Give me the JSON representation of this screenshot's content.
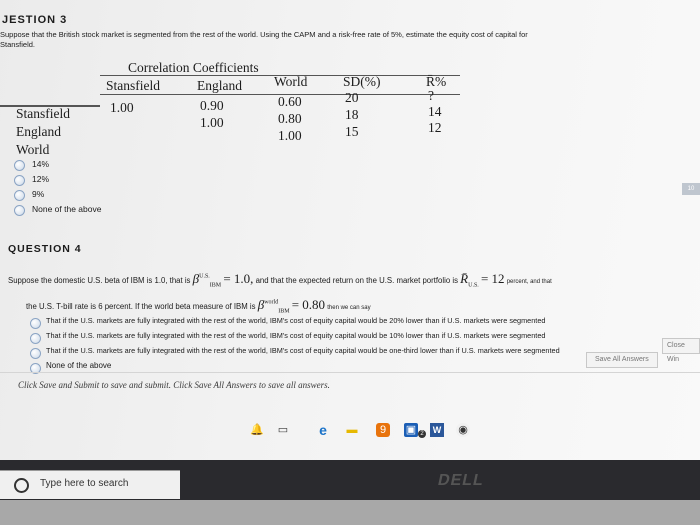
{
  "question3": {
    "title": "JESTION 3",
    "prompt": "Suppose that the British stock market is segmented from the rest of the world. Using the CAPM and a risk-free rate of 5%, estimate the equity cost of capital for",
    "prompt2": "Stansfield.",
    "table": {
      "group_header": "Correlation Coefficients",
      "columns": [
        "Stansfield",
        "England",
        "World",
        "SD(%)",
        "R̄%"
      ],
      "rows": [
        {
          "name": "Stansfield",
          "values": [
            "1.00",
            "0.90",
            "0.60",
            "20",
            "?"
          ]
        },
        {
          "name": "England",
          "values": [
            "",
            "1.00",
            "0.80",
            "18",
            "14"
          ]
        },
        {
          "name": "World",
          "values": [
            "",
            "",
            "1.00",
            "15",
            "12"
          ]
        }
      ]
    },
    "options": [
      "14%",
      "12%",
      "9%",
      "None of the above"
    ]
  },
  "question4": {
    "title": "QUESTION 4",
    "line1_a": "Suppose the domestic U.S. beta of IBM is 1.0, that is",
    "line1_math": "β = 1.0,",
    "line1_beta_sup": "U.S.",
    "line1_beta_sub": "IBM",
    "line1_b": "and that the expected return on the U.S. market portfolio is",
    "line1_math2": "R̄",
    "line1_r_sub": "U.S.",
    "line1_math3": "= 12",
    "line1_c": "percent, and that",
    "line2_a": "the U.S. T-bill rate is 6 percent. If the world beta measure of IBM is",
    "line2_beta_sup": "world",
    "line2_beta_sub": "IBM",
    "line2_math": "= 0.80",
    "line2_b": "then we can say",
    "options": [
      "That if the U.S. markets are fully integrated with the rest of the world, IBM's cost of equity capital would be 20% lower than if U.S. markets were segmented",
      "That if the U.S. markets are fully integrated with the rest of the world, IBM's cost of equity capital would be 10% lower than if U.S. markets were segmented",
      "That if the U.S. markets are fully integrated with the rest of the world, IBM's cost of equity capital would be one-third lower than if U.S. markets were segmented",
      "None of the above"
    ]
  },
  "footer": {
    "instruction": "Click Save and Submit to save and submit. Click Save All Answers to save all answers.",
    "save_all_label": "Save All Answers",
    "close_label": "Close Win",
    "page_badge": "10"
  },
  "taskbar": {
    "search_placeholder": "Type here to search",
    "brand": "DELL",
    "notif_count": "2"
  },
  "colors": {
    "radio_border": "#8ba4c4",
    "taskbar_bg": "#2a2a2e"
  }
}
